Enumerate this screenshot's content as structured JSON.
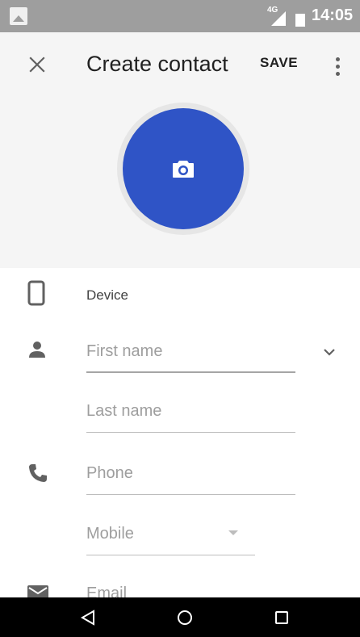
{
  "status_bar": {
    "network": "4G",
    "time": "14:05",
    "icons": [
      "gallery-icon",
      "signal-icon",
      "battery-icon"
    ]
  },
  "toolbar": {
    "title": "Create contact",
    "save_label": "SAVE",
    "icons": [
      "close-icon",
      "more-vert-icon"
    ]
  },
  "photo": {
    "icon": "camera-icon",
    "color": "#2f54c6"
  },
  "account": {
    "label": "Device",
    "icon": "phone-device-icon"
  },
  "fields": {
    "first_name": {
      "placeholder": "First name",
      "icon": "person-icon"
    },
    "last_name": {
      "placeholder": "Last name"
    },
    "phone": {
      "placeholder": "Phone",
      "icon": "phone-icon"
    },
    "phone_type": {
      "value": "Mobile"
    },
    "email": {
      "placeholder": "Email",
      "icon": "email-icon"
    }
  },
  "nav_bar": {
    "icons": [
      "back-icon",
      "home-icon",
      "recents-icon"
    ]
  }
}
